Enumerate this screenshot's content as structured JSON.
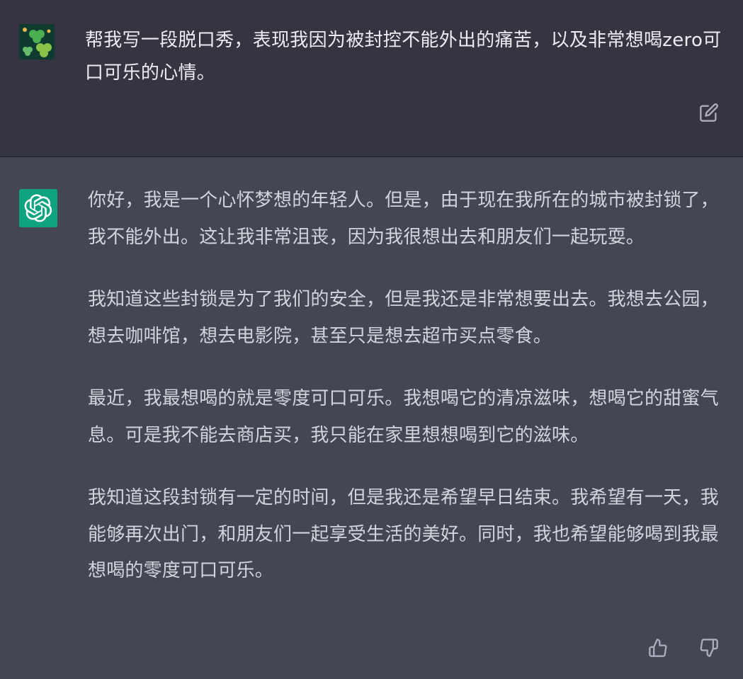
{
  "user_message": {
    "avatar_icon": "clover-avatar-icon",
    "text": "帮我写一段脱口秀，表现我因为被封控不能外出的痛苦，以及非常想喝zero可口可乐的心情。",
    "edit_icon": "edit-icon"
  },
  "assistant_message": {
    "avatar_icon": "openai-logo-icon",
    "paragraphs": [
      "你好，我是一个心怀梦想的年轻人。但是，由于现在我所在的城市被封锁了，我不能外出。这让我非常沮丧，因为我很想出去和朋友们一起玩耍。",
      "我知道这些封锁是为了我们的安全，但是我还是非常想要出去。我想去公园，想去咖啡馆，想去电影院，甚至只是想去超市买点零食。",
      "最近，我最想喝的就是零度可口可乐。我想喝它的清凉滋味，想喝它的甜蜜气息。可是我不能去商店买，我只能在家里想想喝到它的滋味。",
      "我知道这段封锁有一定的时间，但是我还是希望早日结束。我希望有一天，我能够再次出门，和朋友们一起享受生活的美好。同时，我也希望能够喝到我最想喝的零度可口可乐。"
    ],
    "feedback": {
      "thumbs_up_icon": "thumbs-up-icon",
      "thumbs_down_icon": "thumbs-down-icon"
    }
  },
  "colors": {
    "user_bg": "#343541",
    "assistant_bg": "#444654",
    "user_text": "#ececf1",
    "assistant_text": "#d1d5db",
    "openai_green": "#10a37f"
  }
}
